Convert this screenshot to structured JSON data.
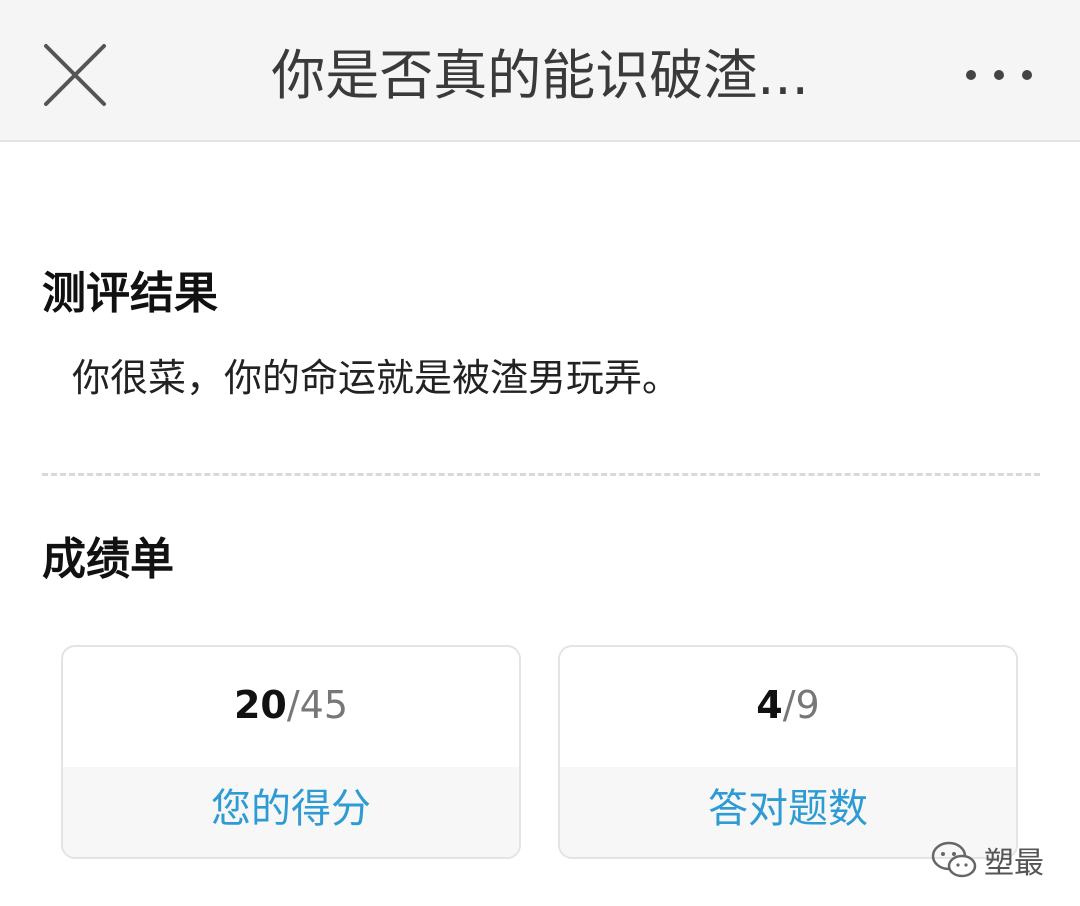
{
  "header": {
    "title": "你是否真的能识破渣...",
    "close_icon": "close-icon",
    "more_icon": "more-dots-icon"
  },
  "result": {
    "heading": "测评结果",
    "text": "你很菜，你的命运就是被渣男玩弄。"
  },
  "scorecard": {
    "heading": "成绩单",
    "cards": [
      {
        "value": "20",
        "total": "/45",
        "label": "您的得分"
      },
      {
        "value": "4",
        "total": "/9",
        "label": "答对题数"
      }
    ]
  },
  "watermark": {
    "text": "塑最",
    "icon": "wechat-icon"
  },
  "colors": {
    "accent": "#2e9bd3",
    "header_bg": "#f5f5f5"
  }
}
